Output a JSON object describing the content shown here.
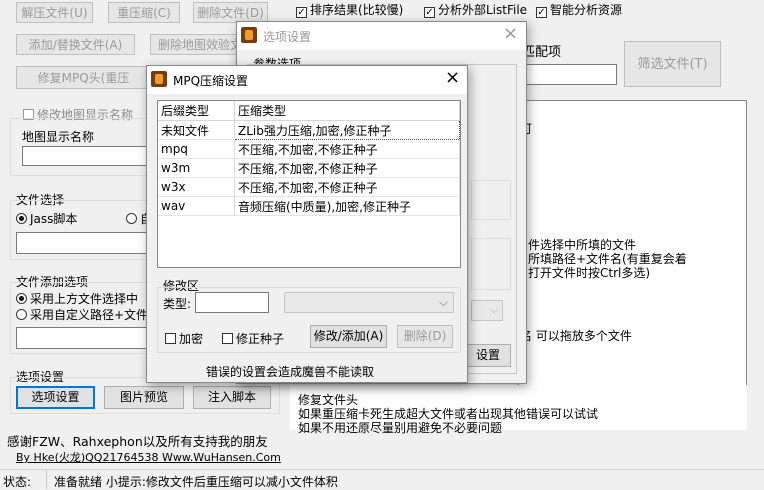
{
  "main": {
    "top_buttons": {
      "extract": "解压文件(U)",
      "recompress": "重压缩(C)",
      "delete_file": "删除文件(D)",
      "add_replace": "添加/替换文件(A)",
      "delete_map_effect": "删除地图效验文",
      "repair_mpq": "修复MPQ头(重压"
    },
    "checkboxes": {
      "sort_results": "排序结果(比较慢)",
      "analyze_listfile": "分析外部ListFile",
      "smart_analysis": "智能分析资源"
    },
    "modify_map_name": "修改地图显示名称",
    "map_display_name": "地图显示名称",
    "file_select": {
      "title": "文件选择",
      "jass": "Jass脚本",
      "other_prefix": "自"
    },
    "file_add": {
      "title": "文件添加选项",
      "use_above": "采用上方文件选择中",
      "use_custom": "采用自定义路径+文件"
    },
    "options": {
      "title": "选项设置",
      "options_button": "选项设置",
      "preview_button": "图片预览",
      "inject_button": "注入脚本"
    },
    "thanks": "感谢FZW、Rahxephon以及所有支持我的朋友",
    "credit": "By Hke(火龙)QQ21764538 Www.WuHansen.Com",
    "match_label": "匹配项",
    "filter_button": "筛选文件(T)",
    "info_lines": [
      "可",
      "件选择中所填的文件",
      "所填路径+文件名(有重复会着",
      "打开文件时按Ctrl多选)",
      "名 可以拖放多个文件",
      "修复文件头",
      "如果重压缩卡死生成超大文件或者出现其他错误可以试试",
      "如果不用还原尽量别用避免不必要问题"
    ],
    "status_label": "状态:",
    "status_text": "准备就绪 小提示:修改文件后重压缩可以减小文件体积"
  },
  "options_dialog": {
    "title": "选项设置",
    "params_label": "参数选项",
    "settings_button_fragment": "设置"
  },
  "mpq_dialog": {
    "title": "MPQ压缩设置",
    "columns": [
      "后缀类型",
      "压缩类型"
    ],
    "rows": [
      [
        "未知文件",
        "ZLib强力压缩,加密,修正种子"
      ],
      [
        "mpq",
        "不压缩,不加密,不修正种子"
      ],
      [
        "w3m",
        "不压缩,不加密,不修正种子"
      ],
      [
        "w3x",
        "不压缩,不加密,不修正种子"
      ],
      [
        "wav",
        "音频压缩(中质量),加密,修正种子"
      ]
    ],
    "modify_area": "修改区",
    "type_label": "类型:",
    "type_value": "",
    "encrypt": "加密",
    "fix_seed": "修正种子",
    "modify_add": "修改/添加(A)",
    "delete": "删除(D)",
    "warning": "错误的设置会造成魔兽不能读取"
  }
}
